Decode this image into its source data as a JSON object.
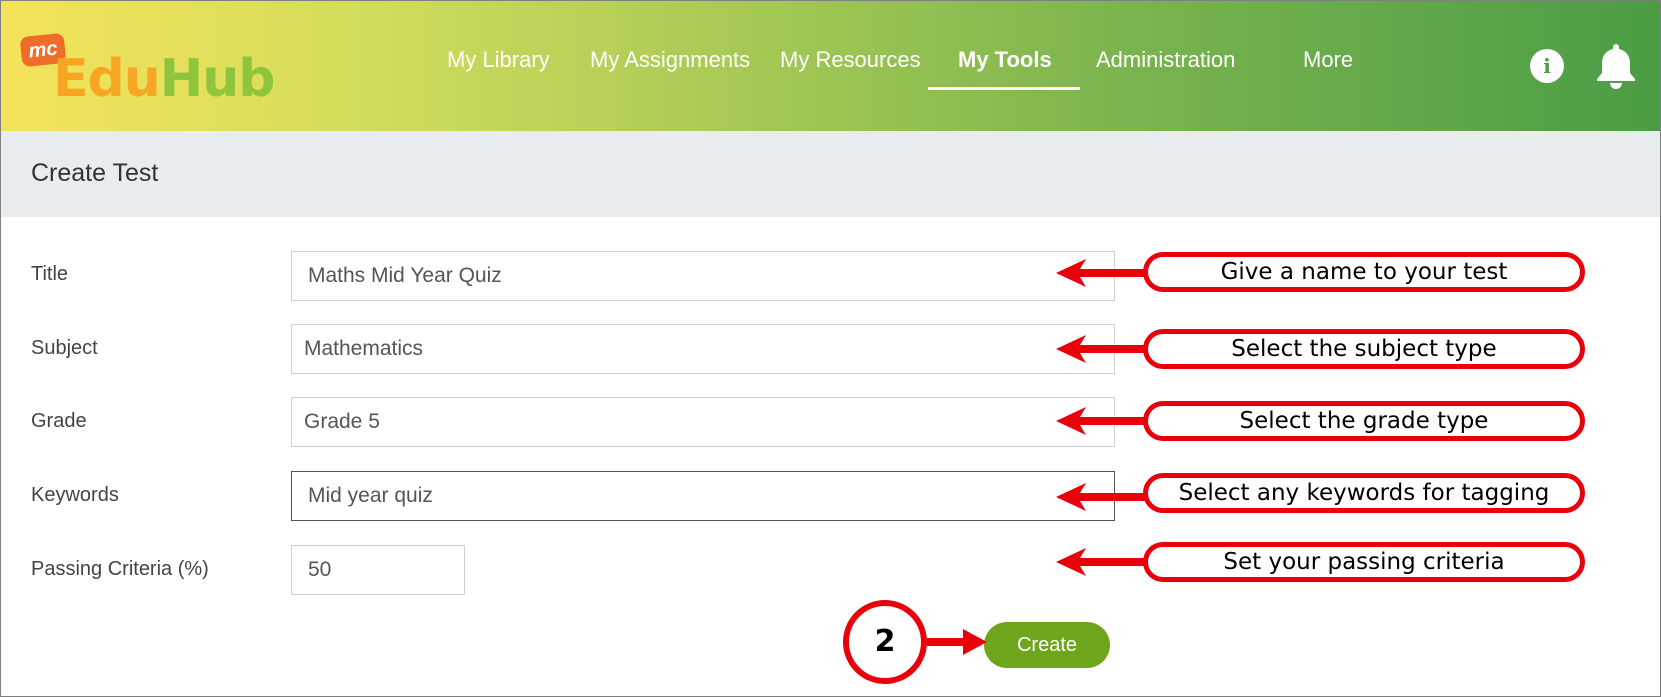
{
  "header": {
    "logo": {
      "badge": "mc",
      "edu": "Edu",
      "hub": "Hub"
    },
    "nav": [
      {
        "label": "My Library"
      },
      {
        "label": "My Assignments"
      },
      {
        "label": "My Resources"
      },
      {
        "label": "My Tools",
        "active": true
      },
      {
        "label": "Administration"
      },
      {
        "label": "More"
      }
    ],
    "icons": [
      "info-icon",
      "bell-icon"
    ]
  },
  "page": {
    "title": "Create Test"
  },
  "form": {
    "title_label": "Title",
    "title_value": "Maths Mid Year Quiz",
    "subject_label": "Subject",
    "subject_value": "Mathematics",
    "grade_label": "Grade",
    "grade_value": "Grade 5",
    "keywords_label": "Keywords",
    "keywords_value": "Mid year quiz",
    "passing_label": "Passing Criteria (%)",
    "passing_value": "50",
    "create_label": "Create"
  },
  "annotations": {
    "callouts": [
      "Give a name to your test",
      "Select the subject type",
      "Select the grade type",
      "Select any keywords for tagging",
      "Set your passing criteria"
    ],
    "step_number": "2",
    "color": "#e8000b"
  },
  "colors": {
    "header_gradient_start": "#f5e35a",
    "header_gradient_end": "#4b9c45",
    "button": "#6fa51a",
    "title_band": "#e9ecef"
  }
}
